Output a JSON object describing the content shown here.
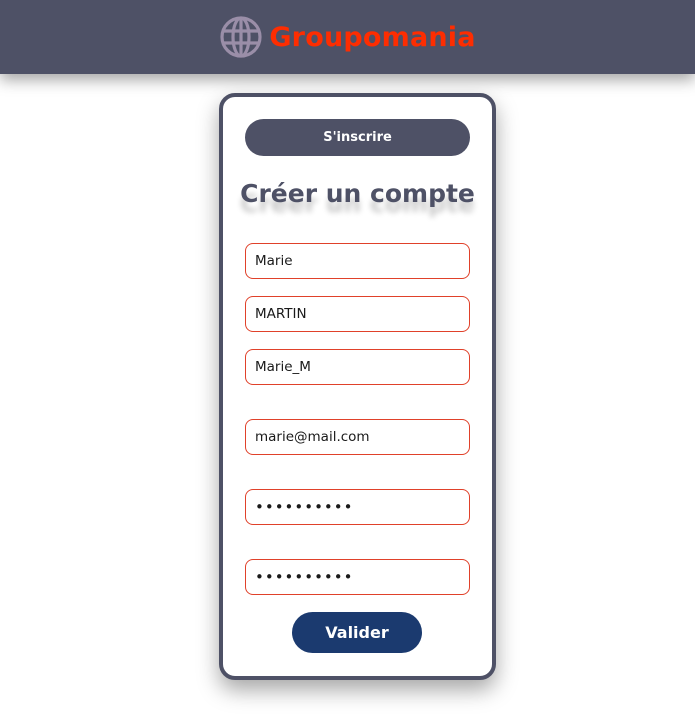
{
  "header": {
    "brand_name": "Groupomania",
    "logo_icon": "globe-icon",
    "background_color": "#4e5166",
    "brand_color": "#fd2d01"
  },
  "signup_form": {
    "signup_label": "S'inscrire",
    "title": "Créer un compte",
    "fields": {
      "first_name": "Marie",
      "last_name": "MARTIN",
      "username": "Marie_M",
      "email": "marie@mail.com",
      "password": "••••••••••",
      "password_confirm": "••••••••••"
    },
    "submit_label": "Valider",
    "accent_color": "#4e5166",
    "field_border_color": "#e0412a",
    "submit_color": "#1b3a6f"
  }
}
